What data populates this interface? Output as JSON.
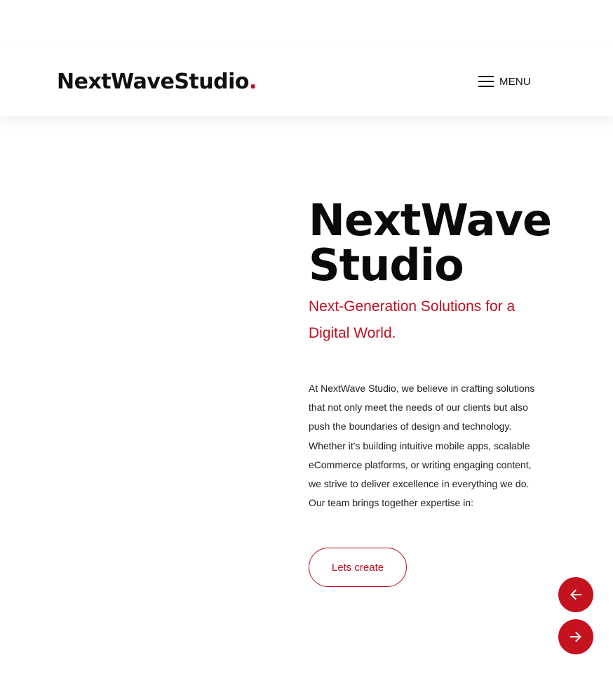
{
  "header": {
    "logo_text": "NextWaveStudio",
    "logo_dot": ".",
    "menu_label": "MENU"
  },
  "hero": {
    "title_line1": "NextWave",
    "title_line2": "Studio",
    "subtitle": "Next-Generation Solutions for a Digital World.",
    "body": "At NextWave Studio, we believe in crafting solutions that not only meet the needs of our clients but also push the boundaries of design and technology. Whether it's building intuitive mobile apps, scalable eCommerce platforms, or writing engaging content, we strive to deliver excellence in everything we do. Our team brings together expertise in:",
    "cta_label": "Lets create"
  },
  "icons": {
    "menu": "hamburger-icon",
    "prev": "arrow-left-icon",
    "next": "arrow-right-icon"
  },
  "colors": {
    "accent": "#c0101f",
    "text": "#111111",
    "background": "#ffffff"
  }
}
